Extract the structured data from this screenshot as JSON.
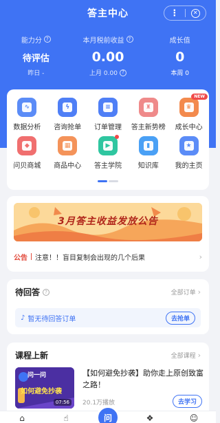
{
  "header": {
    "title": "答主中心"
  },
  "stats": [
    {
      "label": "能力分",
      "value": "待评估",
      "sub": "昨日 -"
    },
    {
      "label": "本月税前收益",
      "value": "0.00",
      "sub": "上月 0.00"
    },
    {
      "label": "成长值",
      "value": "0",
      "sub": "本周 0"
    }
  ],
  "grid": [
    {
      "label": "数据分析",
      "icon": "chart-icon",
      "color": "#5b8cf7",
      "glyph": "∿"
    },
    {
      "label": "咨询抢单",
      "icon": "lightning-icon",
      "color": "#4f7ff6",
      "glyph": "ϟ"
    },
    {
      "label": "订单管理",
      "icon": "document-icon",
      "color": "#4f7ff6",
      "glyph": "≡"
    },
    {
      "label": "答主新势榜",
      "icon": "trophy-icon",
      "color": "#ef8a8a",
      "glyph": "♜"
    },
    {
      "label": "成长中心",
      "icon": "crown-icon",
      "color": "#f38a4d",
      "glyph": "♛",
      "badge": "NEW"
    },
    {
      "label": "问贝商城",
      "icon": "shop-icon",
      "color": "#f06f6f",
      "glyph": "◆"
    },
    {
      "label": "商品中心",
      "icon": "store-icon",
      "color": "#f4935a",
      "glyph": "▦"
    },
    {
      "label": "答主学院",
      "icon": "play-icon",
      "color": "#2fc6a0",
      "glyph": "▶",
      "dot": true
    },
    {
      "label": "知识库",
      "icon": "book-icon",
      "color": "#4aa0f5",
      "glyph": "▮"
    },
    {
      "label": "我的主页",
      "icon": "star-icon",
      "color": "#5b8cf7",
      "glyph": "★"
    }
  ],
  "banner": {
    "text": "3月答主收益发放公告"
  },
  "notice": {
    "tag": "公告",
    "text": "注意！！盲目复制会出现的几个后果"
  },
  "answers": {
    "title": "待回答",
    "link": "全部订单",
    "empty": "暂无待回答订单",
    "button": "去抢单"
  },
  "courses": {
    "title": "课程上新",
    "link": "全部课程",
    "item": {
      "thumb_logo": "问一问",
      "thumb_title": "如何避免抄袭",
      "thumb_time": "07:56",
      "title": "【如何避免抄袭】助你走上原创致富之路！",
      "views": "20.1万播放",
      "button": "去学习"
    }
  },
  "colors": {
    "primary": "#3f73f4",
    "alert": "#e24a3b"
  }
}
